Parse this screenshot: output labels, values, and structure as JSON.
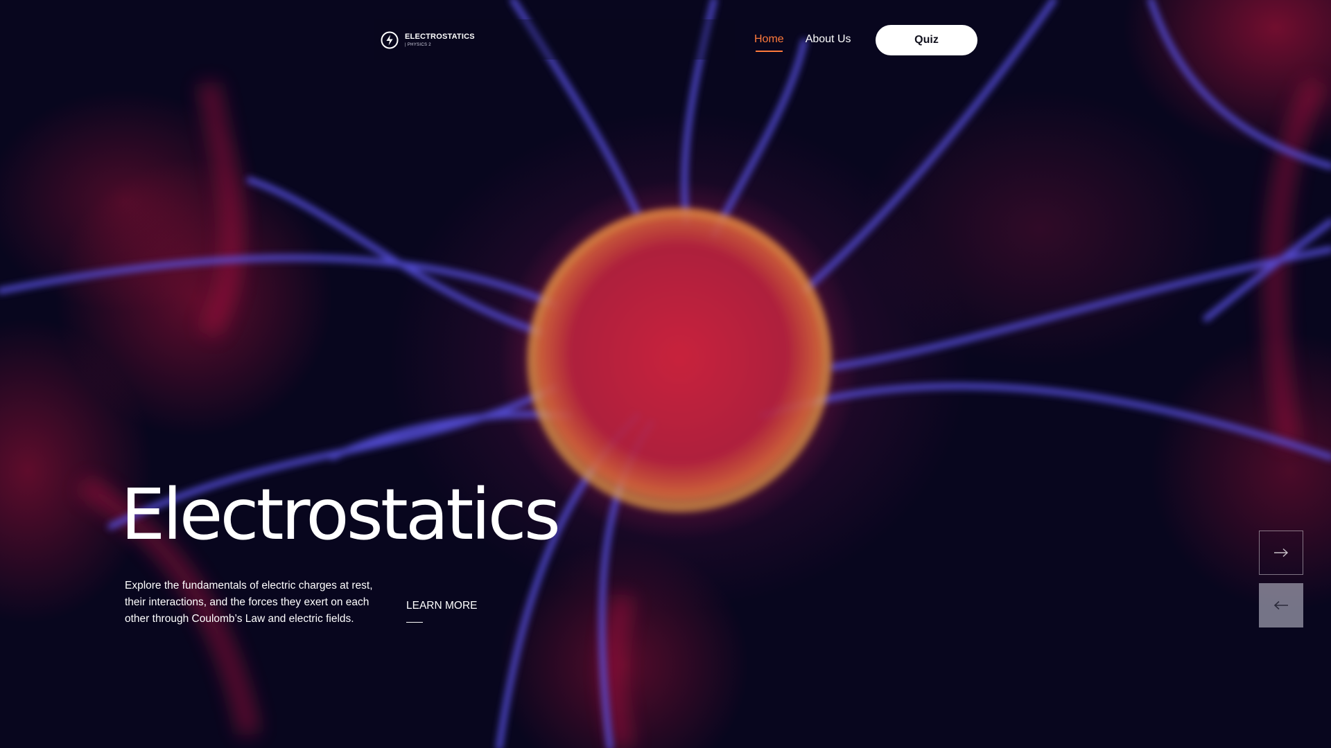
{
  "brand": {
    "title": "ELECTROSTATICS",
    "subtitle": "| PHYSICS 2",
    "logo_icon": "lightning-bolt-icon"
  },
  "nav": {
    "items": [
      {
        "label": "Home",
        "active": true
      },
      {
        "label": "About Us",
        "active": false
      }
    ],
    "quiz_label": "Quiz"
  },
  "hero": {
    "title": "Electrostatics",
    "description": "Explore the fundamentals of electric charges at rest, their interactions, and the forces they exert on each other through Coulomb’s Law and electric fields.",
    "cta_label": "LEARN MORE"
  },
  "slider": {
    "next_icon": "arrow-right-icon",
    "prev_icon": "arrow-left-icon"
  },
  "colors": {
    "accent": "#ff7a3c",
    "background": "#08061e",
    "button_bg": "#ffffff"
  }
}
